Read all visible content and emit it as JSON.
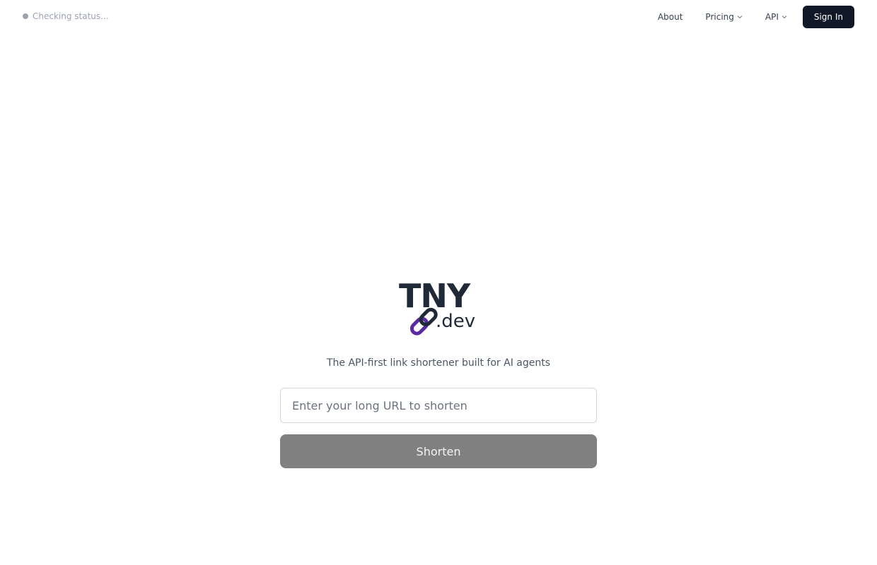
{
  "status": {
    "text": "Checking status...",
    "dot_color": "#9ca3af"
  },
  "nav": {
    "about": "About",
    "pricing": "Pricing",
    "api": "API",
    "sign_in": "Sign In"
  },
  "logo": {
    "top": "TNY",
    "suffix": ".dev",
    "accent": "#5b2aa0"
  },
  "tagline": "The API-first link shortener built for AI agents",
  "form": {
    "url_value": "",
    "url_placeholder": "Enter your long URL to shorten",
    "submit_label": "Shorten"
  },
  "colors": {
    "primary_dark": "#111827",
    "disabled_button": "#808080"
  }
}
